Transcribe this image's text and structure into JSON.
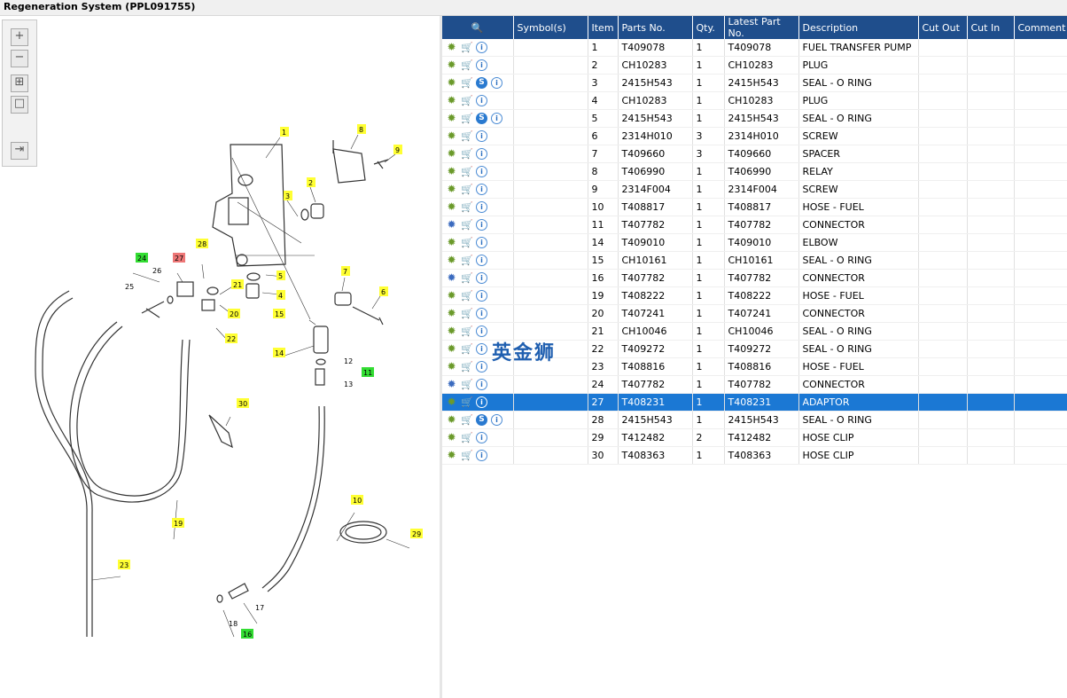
{
  "window": {
    "title": "Regeneration System (PPL091755)"
  },
  "watermark": "英金狮",
  "toolbox": {
    "zoom_in": "+",
    "zoom_out": "−",
    "fit": "⊞",
    "actual": "□",
    "export": "⇥"
  },
  "table": {
    "columns": [
      "",
      "Symbol(s)",
      "Item",
      "Parts No.",
      "Qty.",
      "Latest Part No.",
      "Description",
      "Cut Out",
      "Cut In",
      "Comment"
    ],
    "rows": [
      {
        "icons": [
          "gear",
          "cart",
          "info"
        ],
        "item": "1",
        "part": "T409078",
        "qty": "1",
        "latest": "T409078",
        "desc": "FUEL TRANSFER PUMP"
      },
      {
        "icons": [
          "gear",
          "cart",
          "info"
        ],
        "item": "2",
        "part": "CH10283",
        "qty": "1",
        "latest": "CH10283",
        "desc": "PLUG"
      },
      {
        "icons": [
          "gear",
          "cart",
          "s",
          "info"
        ],
        "item": "3",
        "part": "2415H543",
        "qty": "1",
        "latest": "2415H543",
        "desc": "SEAL - O RING"
      },
      {
        "icons": [
          "gear",
          "cart",
          "info"
        ],
        "item": "4",
        "part": "CH10283",
        "qty": "1",
        "latest": "CH10283",
        "desc": "PLUG"
      },
      {
        "icons": [
          "gear",
          "cart",
          "s",
          "info"
        ],
        "item": "5",
        "part": "2415H543",
        "qty": "1",
        "latest": "2415H543",
        "desc": "SEAL - O RING"
      },
      {
        "icons": [
          "gear",
          "cart",
          "info"
        ],
        "item": "6",
        "part": "2314H010",
        "qty": "3",
        "latest": "2314H010",
        "desc": "SCREW"
      },
      {
        "icons": [
          "gear",
          "cart",
          "info"
        ],
        "item": "7",
        "part": "T409660",
        "qty": "3",
        "latest": "T409660",
        "desc": "SPACER"
      },
      {
        "icons": [
          "gear",
          "cart",
          "info"
        ],
        "item": "8",
        "part": "T406990",
        "qty": "1",
        "latest": "T406990",
        "desc": "RELAY"
      },
      {
        "icons": [
          "gear",
          "cart",
          "info"
        ],
        "item": "9",
        "part": "2314F004",
        "qty": "1",
        "latest": "2314F004",
        "desc": "SCREW"
      },
      {
        "icons": [
          "gear",
          "cart",
          "info"
        ],
        "item": "10",
        "part": "T408817",
        "qty": "1",
        "latest": "T408817",
        "desc": "HOSE - FUEL"
      },
      {
        "icons": [
          "gear2",
          "cart",
          "info"
        ],
        "item": "11",
        "part": "T407782",
        "qty": "1",
        "latest": "T407782",
        "desc": "CONNECTOR"
      },
      {
        "icons": [
          "gear",
          "cart",
          "info"
        ],
        "item": "14",
        "part": "T409010",
        "qty": "1",
        "latest": "T409010",
        "desc": "ELBOW"
      },
      {
        "icons": [
          "gear",
          "cart",
          "info"
        ],
        "item": "15",
        "part": "CH10161",
        "qty": "1",
        "latest": "CH10161",
        "desc": "SEAL - O RING"
      },
      {
        "icons": [
          "gear2",
          "cart",
          "info"
        ],
        "item": "16",
        "part": "T407782",
        "qty": "1",
        "latest": "T407782",
        "desc": "CONNECTOR"
      },
      {
        "icons": [
          "gear",
          "cart",
          "info"
        ],
        "item": "19",
        "part": "T408222",
        "qty": "1",
        "latest": "T408222",
        "desc": "HOSE - FUEL"
      },
      {
        "icons": [
          "gear",
          "cart",
          "info"
        ],
        "item": "20",
        "part": "T407241",
        "qty": "1",
        "latest": "T407241",
        "desc": "CONNECTOR"
      },
      {
        "icons": [
          "gear",
          "cart",
          "info"
        ],
        "item": "21",
        "part": "CH10046",
        "qty": "1",
        "latest": "CH10046",
        "desc": "SEAL - O RING"
      },
      {
        "icons": [
          "gear",
          "cart",
          "info"
        ],
        "item": "22",
        "part": "T409272",
        "qty": "1",
        "latest": "T409272",
        "desc": "SEAL - O RING"
      },
      {
        "icons": [
          "gear",
          "cart",
          "info"
        ],
        "item": "23",
        "part": "T408816",
        "qty": "1",
        "latest": "T408816",
        "desc": "HOSE - FUEL"
      },
      {
        "icons": [
          "gear2",
          "cart",
          "info"
        ],
        "item": "24",
        "part": "T407782",
        "qty": "1",
        "latest": "T407782",
        "desc": "CONNECTOR"
      },
      {
        "icons": [
          "gear",
          "cart",
          "info"
        ],
        "item": "27",
        "part": "T408231",
        "qty": "1",
        "latest": "T408231",
        "desc": "ADAPTOR",
        "selected": true
      },
      {
        "icons": [
          "gear",
          "cart",
          "s",
          "info"
        ],
        "item": "28",
        "part": "2415H543",
        "qty": "1",
        "latest": "2415H543",
        "desc": "SEAL - O RING"
      },
      {
        "icons": [
          "gear",
          "cart",
          "info"
        ],
        "item": "29",
        "part": "T412482",
        "qty": "2",
        "latest": "T412482",
        "desc": "HOSE CLIP"
      },
      {
        "icons": [
          "gear",
          "cart",
          "info"
        ],
        "item": "30",
        "part": "T408363",
        "qty": "1",
        "latest": "T408363",
        "desc": "HOSE CLIP"
      }
    ]
  },
  "diagram": {
    "callouts": [
      "1",
      "2",
      "3",
      "4",
      "5",
      "6",
      "7",
      "8",
      "9",
      "10",
      "11",
      "12",
      "13",
      "14",
      "15",
      "16",
      "17",
      "18",
      "19",
      "20",
      "21",
      "22",
      "23",
      "24",
      "25",
      "26",
      "27",
      "28",
      "29",
      "30"
    ],
    "colors": {
      "yellow": "#ffff33",
      "green": "#33dd33",
      "red": "#ee7777",
      "selected_row": "#1b78d4",
      "header": "#1f4e8c"
    }
  }
}
